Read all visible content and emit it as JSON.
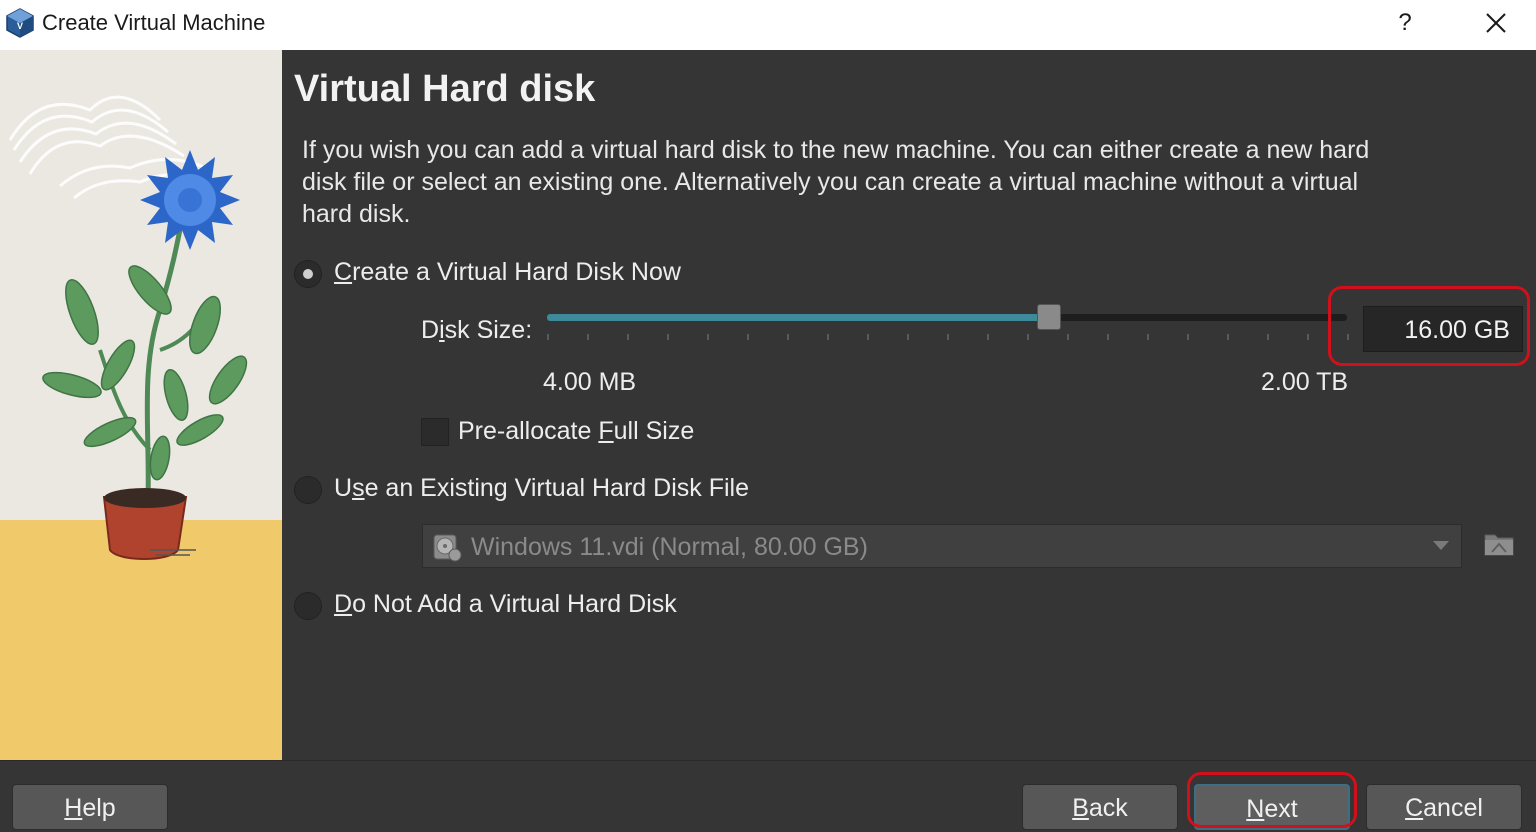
{
  "window": {
    "title": "Create Virtual Machine",
    "help_glyph": "?",
    "app_icon": "virtualbox-icon",
    "close_icon": "close-icon"
  },
  "page": {
    "heading": "Virtual Hard disk",
    "description": "If you wish you can add a virtual hard disk to the new machine. You can either create a new hard disk file or select an existing one. Alternatively you can create a virtual machine without a virtual hard disk."
  },
  "options": {
    "create_now": {
      "prefix": "",
      "mnemonic": "C",
      "rest": "reate a Virtual Hard Disk Now",
      "selected": true
    },
    "use_existing": {
      "prefix": "U",
      "mnemonic": "s",
      "rest": "e an Existing Virtual Hard Disk File",
      "selected": false
    },
    "do_not_add": {
      "prefix": "",
      "mnemonic": "D",
      "rest": "o Not Add a Virtual Hard Disk",
      "selected": false
    }
  },
  "disk_size": {
    "label_prefix": "D",
    "label_mnemonic": "i",
    "label_rest": "sk Size:",
    "value": "16.00 GB",
    "min_label": "4.00 MB",
    "max_label": "2.00 TB",
    "slider_fraction": 0.626
  },
  "preallocate": {
    "prefix": "Pre-allocate ",
    "mnemonic": "F",
    "rest": "ull Size",
    "checked": false
  },
  "existing_file": {
    "selected": "Windows 11.vdi (Normal, 80.00 GB)",
    "icon": "hard-disk-icon",
    "browse_icon": "folder-icon"
  },
  "buttons": {
    "help": {
      "mnemonic": "H",
      "rest": "elp"
    },
    "back": {
      "mnemonic": "B",
      "rest": "ack"
    },
    "next": {
      "mnemonic": "N",
      "rest": "ext"
    },
    "cancel": {
      "mnemonic": "C",
      "rest": "ancel"
    }
  },
  "colors": {
    "accent": "#3d8a9a",
    "annotation": "#d0101a",
    "background": "#353535"
  }
}
